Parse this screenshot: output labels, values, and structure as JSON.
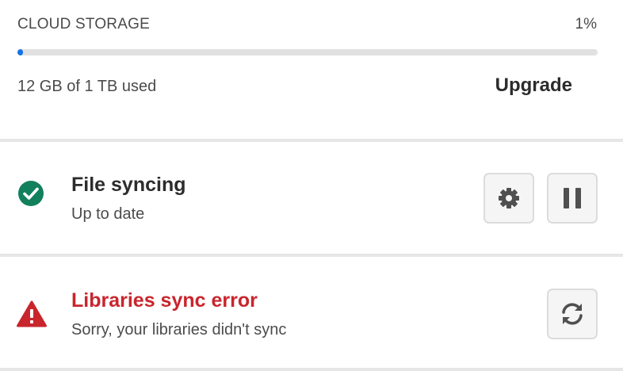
{
  "storage": {
    "title": "CLOUD STORAGE",
    "percent_label": "1%",
    "percent_value": 1,
    "usage": "12 GB of 1 TB used",
    "upgrade_label": "Upgrade"
  },
  "file_sync": {
    "title": "File syncing",
    "status": "Up to date",
    "icon": "check-circle-icon",
    "icon_color": "#12805c"
  },
  "libraries": {
    "title": "Libraries sync error",
    "status": "Sorry, your libraries didn't sync",
    "icon": "warning-triangle-icon",
    "icon_color": "#c9252d"
  },
  "colors": {
    "accent": "#1473e6",
    "error": "#c9252d",
    "success": "#12805c"
  }
}
